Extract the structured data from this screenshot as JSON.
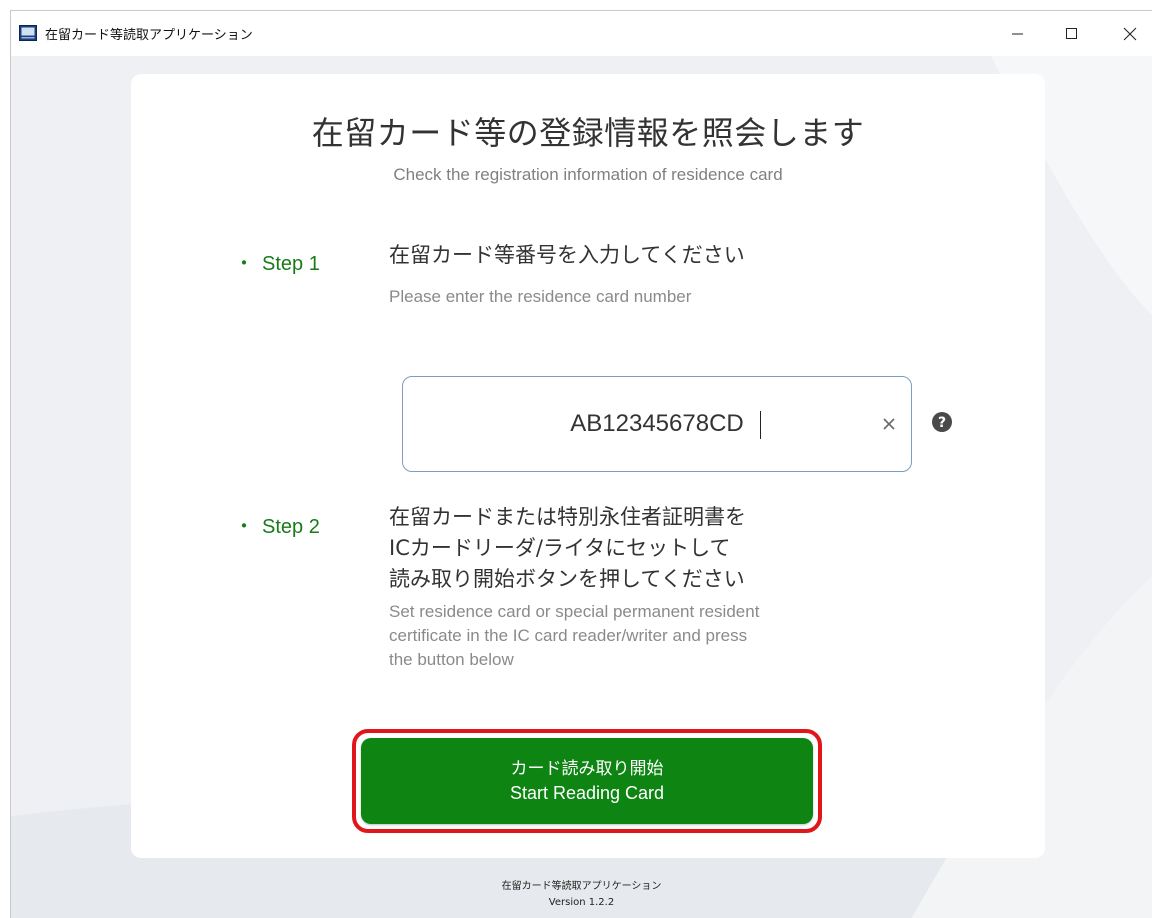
{
  "window": {
    "title": "在留カード等読取アプリケーション",
    "icon": "app-window-icon"
  },
  "header": {
    "title": "在留カード等の登録情報を照会します",
    "subtitle": "Check the registration information of residence card"
  },
  "step1": {
    "label": "Step 1",
    "instruction_jp": "在留カード等番号を入力してください",
    "instruction_en": "Please enter the residence card number"
  },
  "card_input": {
    "value": "AB12345678CD"
  },
  "step2": {
    "label": "Step 2",
    "instruction_jp": [
      "在留カードまたは特別永住者証明書を",
      "ICカードリーダ/ライタにセットして",
      "読み取り開始ボタンを押してください"
    ],
    "instruction_en": [
      "Set residence card or special permanent resident",
      "certificate in the IC card reader/writer and press",
      "the button below"
    ]
  },
  "start_button": {
    "label_jp": "カード読み取り開始",
    "label_en": "Start Reading Card"
  },
  "footer": {
    "app_name": "在留カード等読取アプリケーション",
    "version": "Version 1.2.2"
  },
  "colors": {
    "accent_green": "#0e8413",
    "step_green": "#1a7a1a",
    "highlight_red": "#e0161b"
  }
}
